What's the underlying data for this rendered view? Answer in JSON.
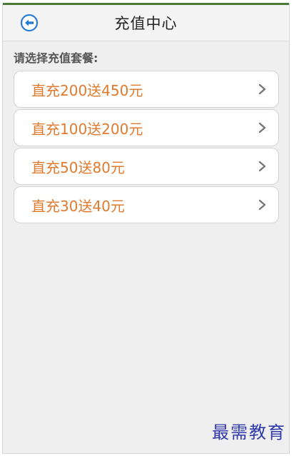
{
  "header": {
    "title": "充值中心",
    "back_icon": "back-arrow-circle-icon",
    "accent_color": "#2a7bd6"
  },
  "prompt": "请选择充值套餐:",
  "packages": [
    {
      "label": "直充200送450元"
    },
    {
      "label": "直充100送200元"
    },
    {
      "label": "直充50送80元"
    },
    {
      "label": "直充30送40元"
    }
  ],
  "item_text_color": "#e07a2e",
  "watermark": "最需教育"
}
